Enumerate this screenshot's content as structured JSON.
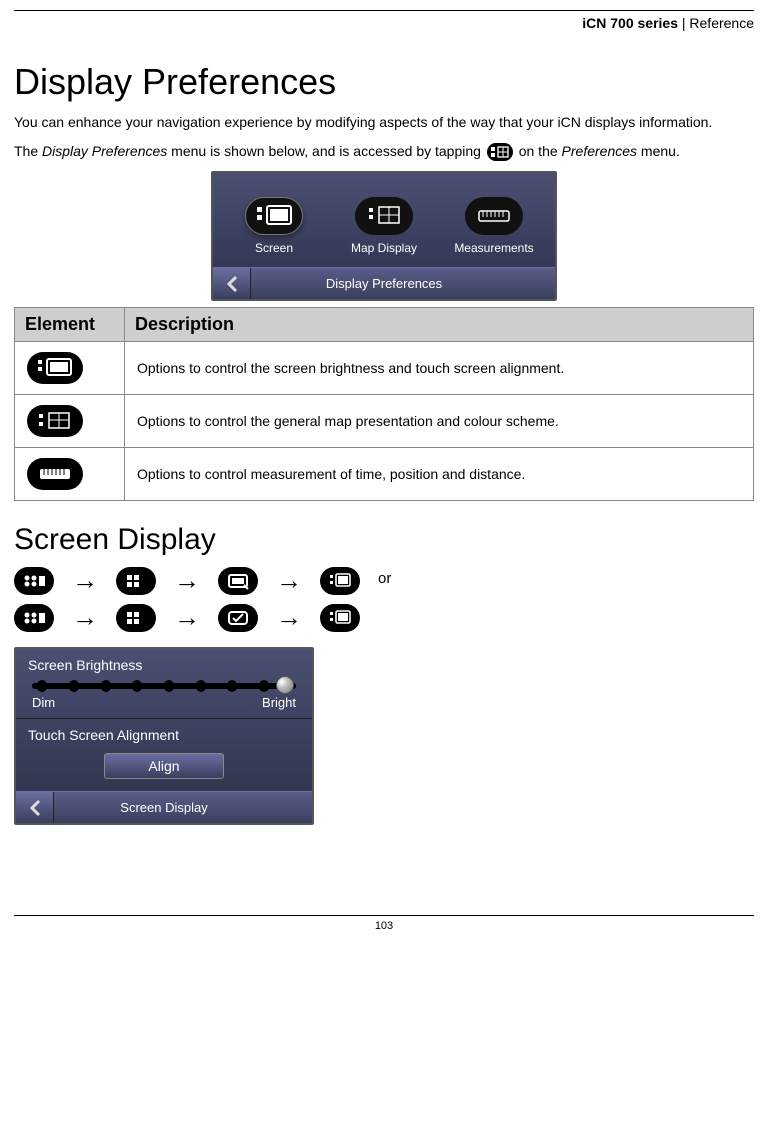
{
  "header": {
    "product": "iCN 700 series",
    "sep": "  |  ",
    "section": "Reference"
  },
  "h1": "Display Preferences",
  "intro": "You can enhance your navigation experience by modifying aspects of the way that your iCN displays information.",
  "intro2_a": "The ",
  "intro2_b": "Display Preferences",
  "intro2_c": " menu is shown below, and is accessed by tapping ",
  "intro2_d": " on the ",
  "intro2_e": "Preferences",
  "intro2_f": " menu.",
  "dp_screenshot": {
    "items": [
      "Screen",
      "Map Display",
      "Measurements"
    ],
    "title": "Display Preferences"
  },
  "table": {
    "h_elem": "Element",
    "h_desc": "Description",
    "rows": [
      {
        "icon": "screen-icon",
        "desc": "Options to control the screen brightness and touch screen alignment."
      },
      {
        "icon": "mapdisplay-icon",
        "desc": "Options to control the general map presentation and colour scheme."
      },
      {
        "icon": "measure-icon",
        "desc": "Options to control measurement of time, position and distance."
      }
    ]
  },
  "h2": "Screen Display",
  "nav_or": "or",
  "sd_screenshot": {
    "brightness_label": "Screen Brightness",
    "dim": "Dim",
    "bright": "Bright",
    "align_label": "Touch Screen Alignment",
    "align_btn": "Align",
    "title": "Screen Display"
  },
  "page_number": "103"
}
